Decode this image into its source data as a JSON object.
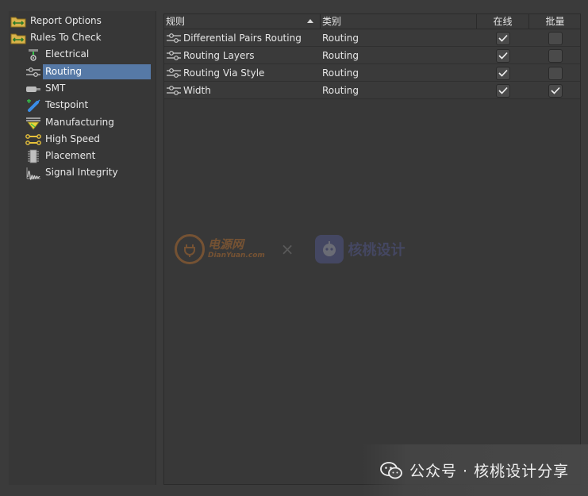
{
  "tree": {
    "items": [
      {
        "label": "Report Options",
        "icon": "folder-rules-icon",
        "selected": false
      },
      {
        "label": "Rules To Check",
        "icon": "folder-rules-icon",
        "selected": false
      },
      {
        "label": "Electrical",
        "icon": "electrical-icon",
        "selected": false
      },
      {
        "label": "Routing",
        "icon": "routing-icon",
        "selected": true
      },
      {
        "label": "SMT",
        "icon": "smt-icon",
        "selected": false
      },
      {
        "label": "Testpoint",
        "icon": "testpoint-icon",
        "selected": false
      },
      {
        "label": "Manufacturing",
        "icon": "manufacturing-icon",
        "selected": false
      },
      {
        "label": "High Speed",
        "icon": "high-speed-icon",
        "selected": false
      },
      {
        "label": "Placement",
        "icon": "placement-icon",
        "selected": false
      },
      {
        "label": "Signal Integrity",
        "icon": "signal-integrity-icon",
        "selected": false
      }
    ]
  },
  "grid": {
    "headers": {
      "rule": "规则",
      "category": "类别",
      "online": "在线",
      "batch": "批量"
    },
    "rows": [
      {
        "rule": "Differential Pairs Routing",
        "category": "Routing",
        "online": true,
        "batch": false
      },
      {
        "rule": "Routing Layers",
        "category": "Routing",
        "online": true,
        "batch": false
      },
      {
        "rule": "Routing Via Style",
        "category": "Routing",
        "online": true,
        "batch": false
      },
      {
        "rule": "Width",
        "category": "Routing",
        "online": true,
        "batch": true
      }
    ]
  },
  "watermarks": {
    "center_brand_1": "电源网",
    "center_brand_1_sub": "DianYuan.com",
    "center_separator": "×",
    "center_brand_2": "核桃设计",
    "bottom_text": "公众号 · 核桃设计分享"
  },
  "colors": {
    "selection": "#5679a6",
    "background": "#3b3b3b",
    "panel": "#373737"
  }
}
